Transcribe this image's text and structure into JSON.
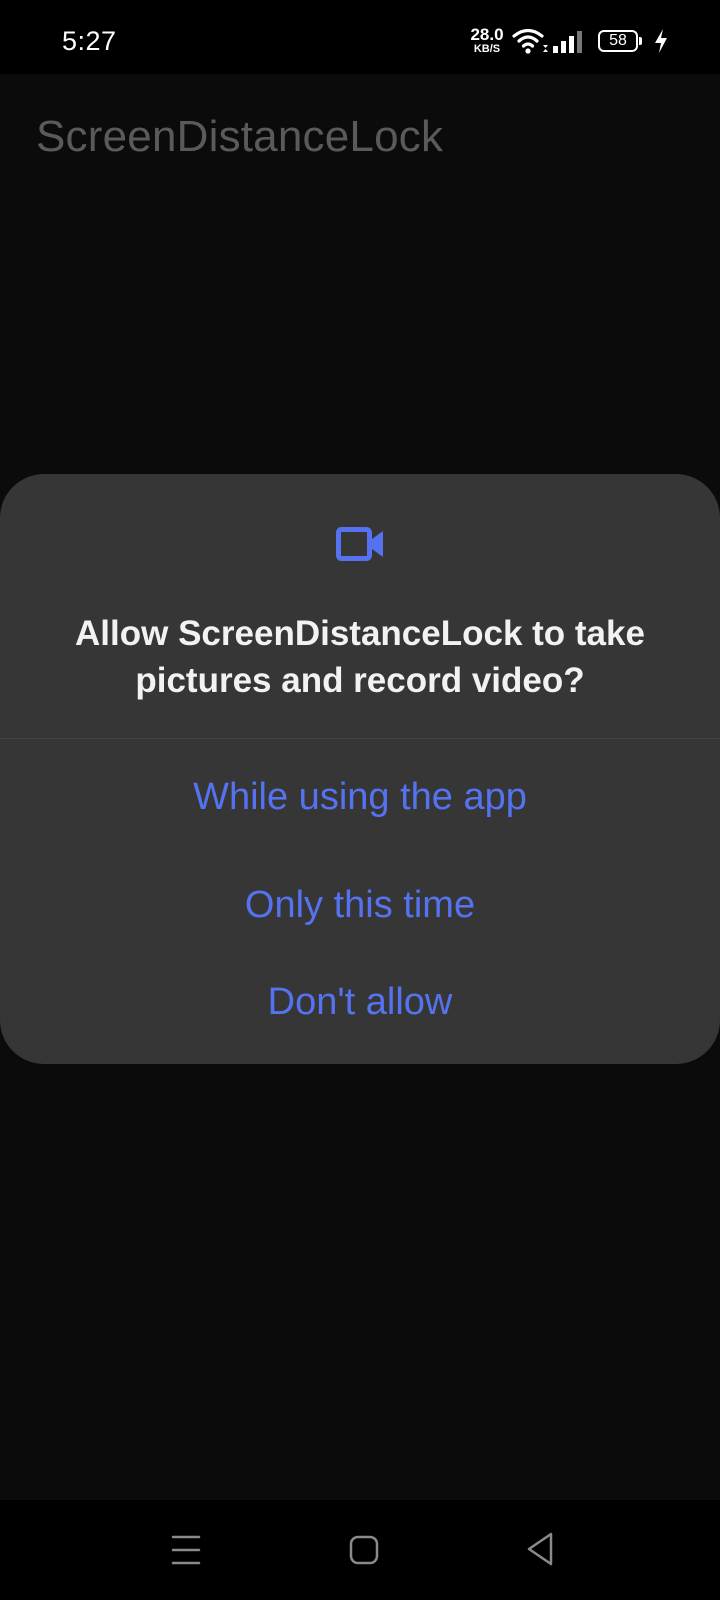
{
  "status_bar": {
    "time": "5:27",
    "net_speed_value": "28.0",
    "net_speed_unit": "KB/S",
    "battery_level": "58",
    "icons": [
      "wifi-icon",
      "signal-icon",
      "battery-icon",
      "charging-bolt-icon"
    ]
  },
  "app": {
    "title": "ScreenDistanceLock"
  },
  "permission_dialog": {
    "icon": "video-camera-icon",
    "message": "Allow ScreenDistanceLock to take pictures and record video?",
    "buttons": {
      "while_using": "While using the app",
      "only_this_time": "Only this time",
      "dont_allow": "Don't allow"
    }
  },
  "nav_bar": {
    "icons": [
      "recent-apps-icon",
      "home-icon",
      "back-icon"
    ]
  },
  "colors": {
    "accent": "#5573f0",
    "dialog_background": "#363636",
    "screen_background": "#0b0b0b",
    "app_title": "#5a5a5a"
  }
}
